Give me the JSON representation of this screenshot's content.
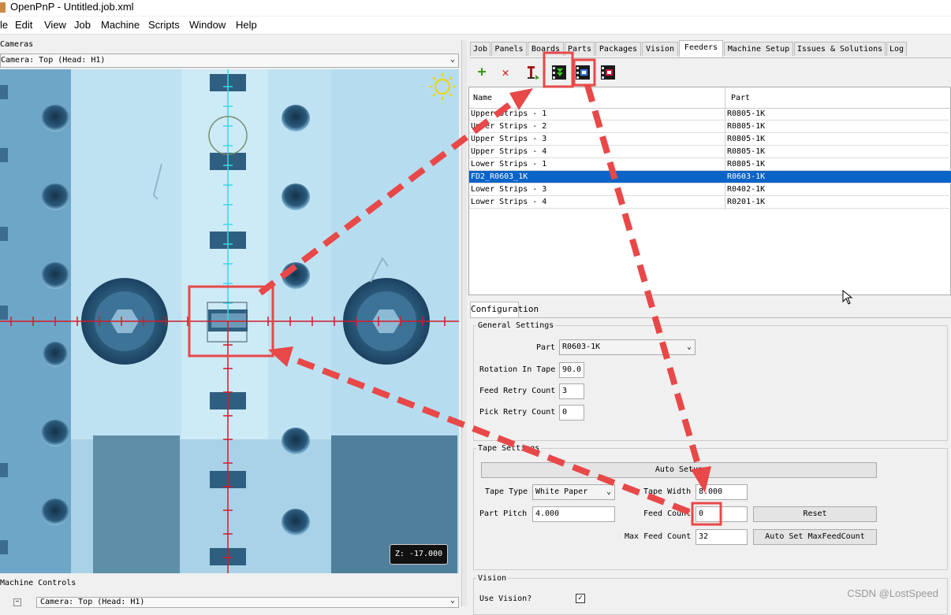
{
  "app": {
    "title": "OpenPnP - Untitled.job.xml"
  },
  "menu": [
    "le",
    "Edit",
    "View",
    "Job",
    "Machine",
    "Scripts",
    "Window",
    "Help"
  ],
  "cameras": {
    "panel_title": "Cameras",
    "selected": "Camera: Top (Head: H1)",
    "z_readout": "Z: -17.000"
  },
  "machine_controls": {
    "panel_title": "Machine Controls",
    "selected": "Camera: Top (Head: H1)",
    "tree_toggle": "−"
  },
  "tabs": [
    "Job",
    "Panels",
    "Boards",
    "Parts",
    "Packages",
    "Vision",
    "Feeders",
    "Machine Setup",
    "Issues & Solutions",
    "Log"
  ],
  "active_tab": "Feeders",
  "toolbar": {
    "add": "+",
    "delete": "✕"
  },
  "feeder_table": {
    "columns": [
      "Name",
      "Part"
    ],
    "rows": [
      {
        "name": "Upper Strips - 1",
        "part": "R0805-1K"
      },
      {
        "name": "Upper Strips - 2",
        "part": "R0805-1K"
      },
      {
        "name": "Upper Strips - 3",
        "part": "R0805-1K"
      },
      {
        "name": "Upper Strips - 4",
        "part": "R0805-1K"
      },
      {
        "name": "Lower Strips - 1",
        "part": "R0805-1K"
      },
      {
        "name": "FD2_R0603_1K",
        "part": "R0603-1K"
      },
      {
        "name": "Lower Strips - 3",
        "part": "R0402-1K"
      },
      {
        "name": "Lower Strips - 4",
        "part": "R0201-1K"
      }
    ],
    "selected_row": 5
  },
  "configuration": {
    "tab_label": "Configuration",
    "general": {
      "legend": "General Settings",
      "part_label": "Part",
      "part_value": "R0603-1K",
      "rotation_label": "Rotation In Tape",
      "rotation_value": "90.0",
      "feed_retry_label": "Feed Retry Count",
      "feed_retry_value": "3",
      "pick_retry_label": "Pick Retry Count",
      "pick_retry_value": "0"
    },
    "tape": {
      "legend": "Tape Settings",
      "auto_setup": "Auto Setup",
      "tape_type_label": "Tape Type",
      "tape_type_value": "White Paper",
      "tape_width_label": "Tape Width",
      "tape_width_value": "8.000",
      "part_pitch_label": "Part Pitch",
      "part_pitch_value": "4.000",
      "feed_count_label": "Feed Count",
      "feed_count_value": "0",
      "reset": "Reset",
      "max_feed_label": "Max Feed Count",
      "max_feed_value": "32",
      "auto_set_max": "Auto Set MaxFeedCount"
    },
    "vision": {
      "legend": "Vision",
      "use_vision_label": "Use Vision?",
      "use_vision_checked": true,
      "check_mark": "✓"
    }
  },
  "watermark": "CSDN @LostSpeed",
  "colors": {
    "selection": "#0a64c8",
    "annotation": "#e84848",
    "crosshair_h": "#d41a2a",
    "crosshair_v": "#3ad8e8"
  }
}
